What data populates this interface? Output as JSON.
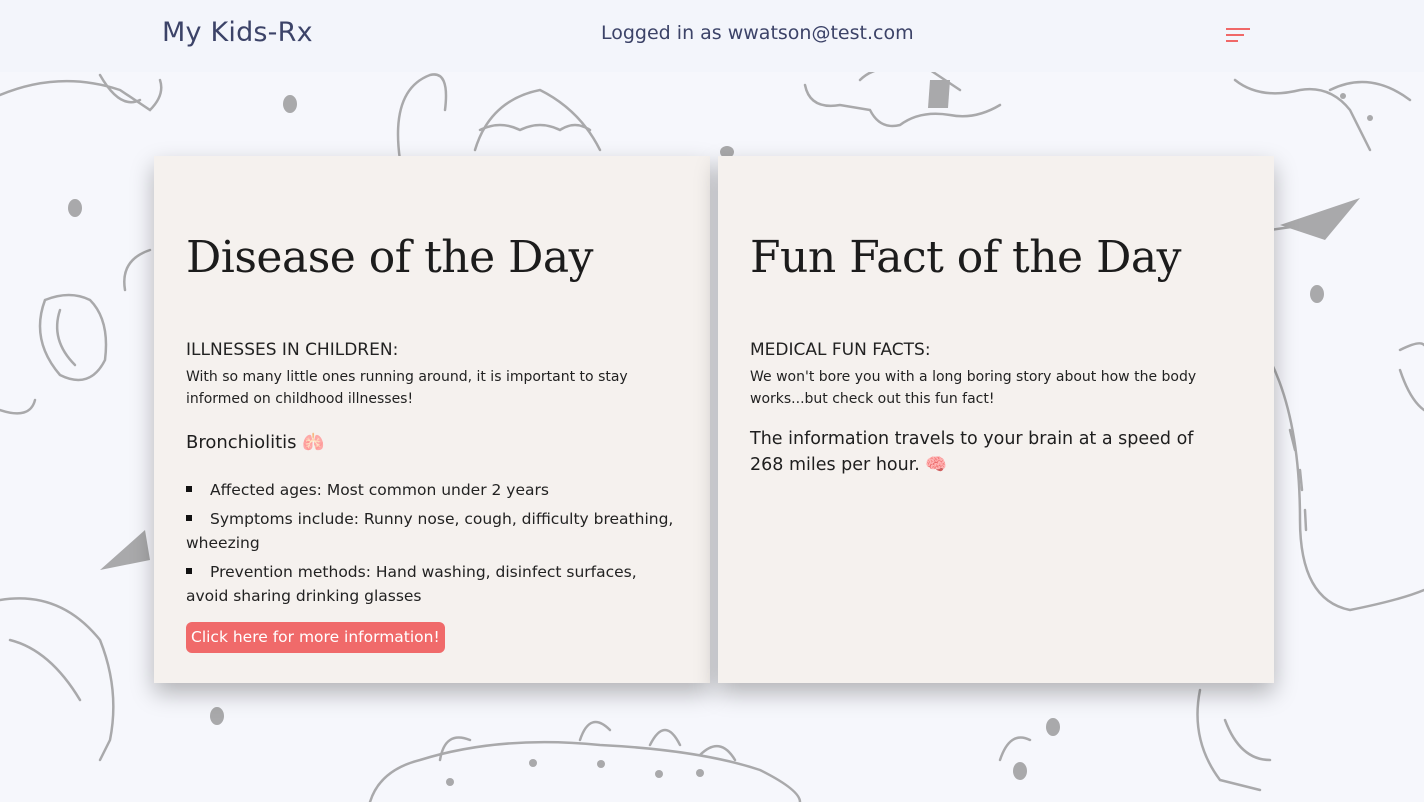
{
  "header": {
    "brand": "My Kids-Rx",
    "login_text": "Logged in as wwatson@test.com",
    "menu_icon": "menu-icon",
    "accent_color": "#f06868"
  },
  "disease_card": {
    "title": "Disease of the Day",
    "subheading": "ILLNESSES IN CHILDREN:",
    "intro": "With so many little ones running around, it is important to stay informed on childhood illnesses!",
    "disease_name": "Bronchiolitis 🫁",
    "facts": [
      "Affected ages: Most common under 2 years",
      "Symptoms include: Runny nose, cough, difficulty breathing, wheezing",
      "Prevention methods: Hand washing, disinfect surfaces, avoid sharing drinking glasses"
    ],
    "button_label": "Click here for more information!"
  },
  "fun_fact_card": {
    "title": "Fun Fact of the Day",
    "subheading": "MEDICAL FUN FACTS:",
    "intro": "We won't bore you with a long boring story about how the body works...but check out this fun fact!",
    "fact": "The information travels to your brain at a speed of 268 miles per hour. 🧠"
  },
  "colors": {
    "card_background": "#f5f1ee",
    "page_background": "#f6f7fc",
    "button_color": "#f06a6a"
  }
}
